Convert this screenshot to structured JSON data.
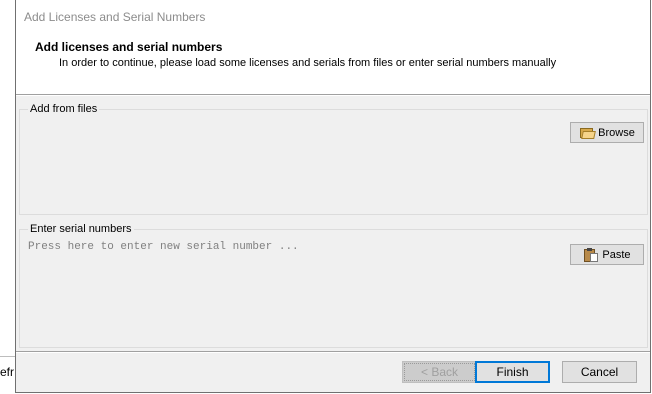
{
  "background": {
    "partial_text": "efr"
  },
  "dialog": {
    "title": "Add Licenses and Serial Numbers",
    "header": {
      "title": "Add licenses and serial numbers",
      "subtitle": "In order to continue, please load some licenses and serials from files or enter serial numbers manually"
    },
    "files_group": {
      "label": "Add from files",
      "browse_label": "Browse",
      "browse_icon": "folder-icon"
    },
    "serial_group": {
      "label": "Enter serial numbers",
      "placeholder": "Press here to enter new serial number ...",
      "paste_label": "Paste",
      "paste_icon": "clipboard-icon"
    },
    "footer": {
      "back_label": "< Back",
      "finish_label": "Finish",
      "cancel_label": "Cancel"
    }
  },
  "colors": {
    "dialog_bg": "#f0f0f0",
    "header_bg": "#ffffff",
    "default_button_border": "#0078d7",
    "placeholder_text": "#808080"
  }
}
